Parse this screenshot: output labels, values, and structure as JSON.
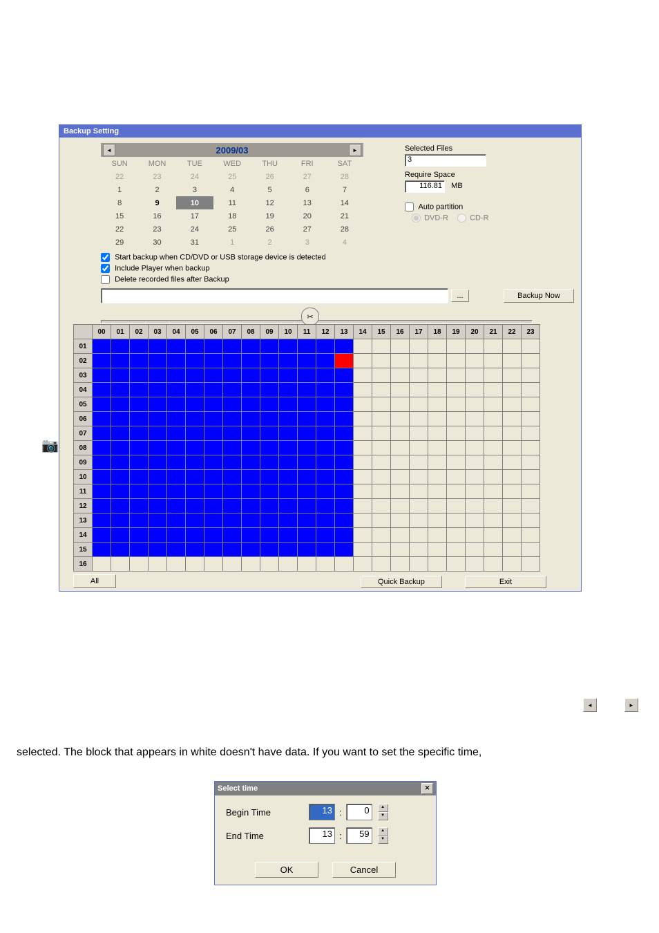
{
  "backup": {
    "title": "Backup Setting",
    "calendar": {
      "month_label": "2009/03",
      "days": [
        "SUN",
        "MON",
        "TUE",
        "WED",
        "THU",
        "FRI",
        "SAT"
      ],
      "rows": [
        [
          {
            "n": "22",
            "dim": true
          },
          {
            "n": "23",
            "dim": true
          },
          {
            "n": "24",
            "dim": true
          },
          {
            "n": "25",
            "dim": true
          },
          {
            "n": "26",
            "dim": true
          },
          {
            "n": "27",
            "dim": true
          },
          {
            "n": "28",
            "dim": true
          }
        ],
        [
          {
            "n": "1"
          },
          {
            "n": "2"
          },
          {
            "n": "3"
          },
          {
            "n": "4"
          },
          {
            "n": "5"
          },
          {
            "n": "6"
          },
          {
            "n": "7"
          }
        ],
        [
          {
            "n": "8"
          },
          {
            "n": "9",
            "bold": true
          },
          {
            "n": "10",
            "sel": true
          },
          {
            "n": "11"
          },
          {
            "n": "12"
          },
          {
            "n": "13"
          },
          {
            "n": "14"
          }
        ],
        [
          {
            "n": "15"
          },
          {
            "n": "16"
          },
          {
            "n": "17"
          },
          {
            "n": "18"
          },
          {
            "n": "19"
          },
          {
            "n": "20"
          },
          {
            "n": "21"
          }
        ],
        [
          {
            "n": "22"
          },
          {
            "n": "23"
          },
          {
            "n": "24"
          },
          {
            "n": "25"
          },
          {
            "n": "26"
          },
          {
            "n": "27"
          },
          {
            "n": "28"
          }
        ],
        [
          {
            "n": "29"
          },
          {
            "n": "30"
          },
          {
            "n": "31"
          },
          {
            "n": "1",
            "dim": true
          },
          {
            "n": "2",
            "dim": true
          },
          {
            "n": "3",
            "dim": true
          },
          {
            "n": "4",
            "dim": true
          }
        ]
      ]
    },
    "selected_files_label": "Selected Files",
    "selected_files_value": "3",
    "require_space_label": "Require Space",
    "require_space_value": "116.81",
    "require_space_unit": "MB",
    "auto_partition_label": "Auto partition",
    "dvd_label": "DVD-R",
    "cd_label": "CD-R",
    "chk_start_label": "Start backup when CD/DVD or USB storage device is detected",
    "chk_include_label": "Include Player when backup",
    "chk_delete_label": "Delete recorded files after Backup",
    "browse_label": "...",
    "backup_now_label": "Backup Now",
    "hours": [
      "00",
      "01",
      "02",
      "03",
      "04",
      "05",
      "06",
      "07",
      "08",
      "09",
      "10",
      "11",
      "12",
      "13",
      "14",
      "15",
      "16",
      "17",
      "18",
      "19",
      "20",
      "21",
      "22",
      "23"
    ],
    "channels": [
      "01",
      "02",
      "03",
      "04",
      "05",
      "06",
      "07",
      "08",
      "09",
      "10",
      "11",
      "12",
      "13",
      "14",
      "15",
      "16"
    ],
    "blue_limit": 13,
    "red_cell": {
      "row": "02",
      "col": 13
    },
    "all_label": "All",
    "quick_backup_label": "Quick Backup",
    "exit_label": "Exit"
  },
  "caption": "selected. The block that appears in white doesn't have data. If you want to set the specific time,",
  "select_time": {
    "title": "Select time",
    "begin_label": "Begin Time",
    "end_label": "End Time",
    "begin_h": "13",
    "begin_m": "0",
    "end_h": "13",
    "end_m": "59",
    "ok": "OK",
    "cancel": "Cancel"
  }
}
